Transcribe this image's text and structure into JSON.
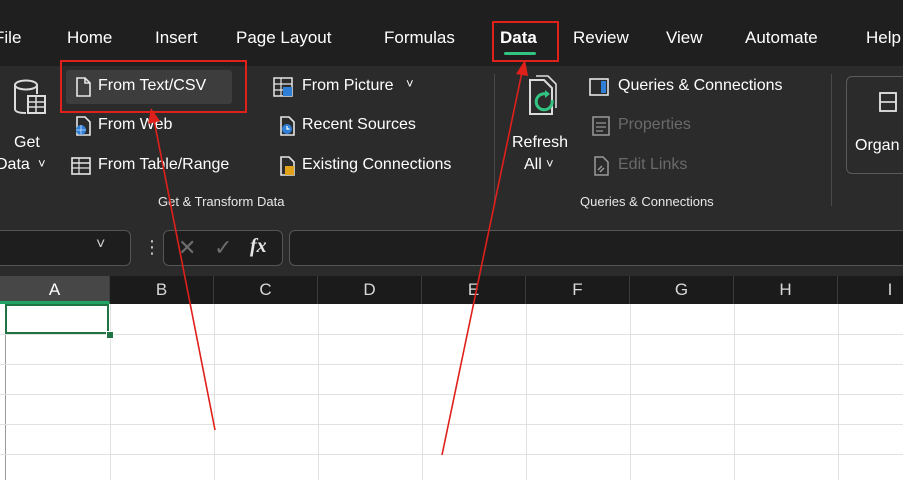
{
  "menu_tabs": [
    "File",
    "Home",
    "Insert",
    "Page Layout",
    "Formulas",
    "Data",
    "Review",
    "View",
    "Automate",
    "Help"
  ],
  "active_tab": "Data",
  "ribbon": {
    "get_data": {
      "line1": "Get",
      "line2": "Data",
      "caret": "˅"
    },
    "get_transform": {
      "from_text_csv": "From Text/CSV",
      "from_web": "From Web",
      "from_table_range": "From Table/Range",
      "from_picture": "From Picture",
      "from_picture_caret": "˅",
      "recent_sources": "Recent Sources",
      "existing_connections": "Existing Connections",
      "group_label": "Get & Transform Data"
    },
    "queries": {
      "refresh_line1": "Refresh",
      "refresh_line2": "All",
      "refresh_caret": "˅",
      "queries_connections": "Queries & Connections",
      "properties": "Properties",
      "edit_links": "Edit Links",
      "group_label": "Queries & Connections"
    },
    "organize": {
      "label": "Organ"
    }
  },
  "formula_bar": {
    "fx": "fx",
    "name_box_caret": "˅",
    "more": "⋮"
  },
  "columns": [
    "A",
    "B",
    "C",
    "D",
    "E",
    "F",
    "G",
    "H",
    "I"
  ],
  "selected_column": "A",
  "colors": {
    "accent_green": "#21a366",
    "annotation_red": "#e0201b",
    "ribbon_bg": "#2b2b2b",
    "menubar_bg": "#1f1f1f"
  }
}
